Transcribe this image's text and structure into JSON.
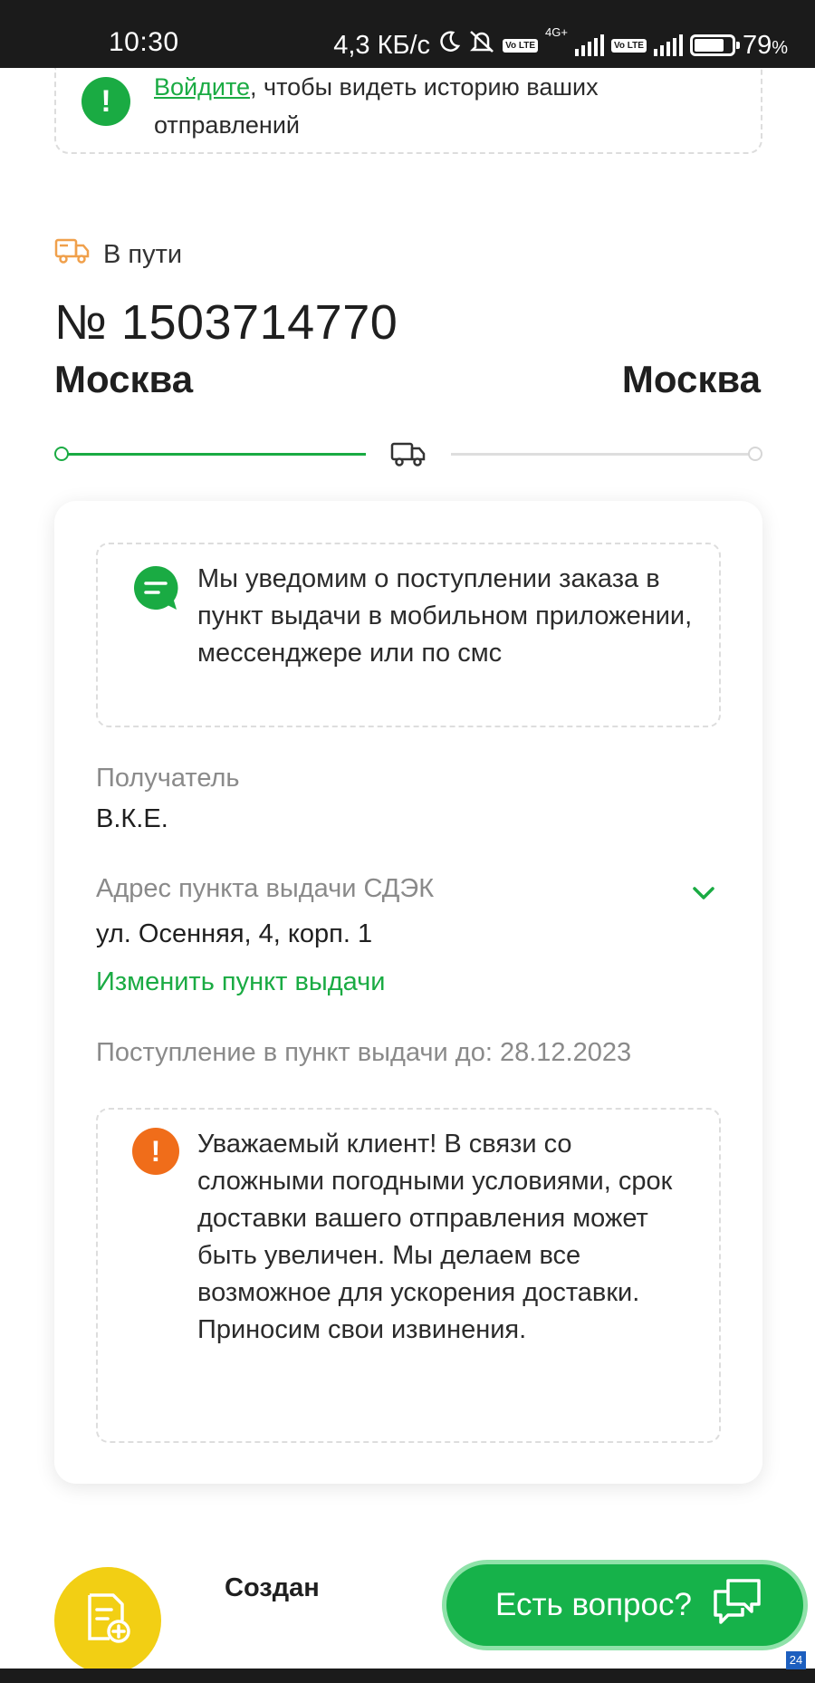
{
  "status_bar": {
    "time": "10:30",
    "network_speed": "4,3 КБ/с",
    "lte_chip": "Vo LTE",
    "network_type": "4G+",
    "battery_percent": "79",
    "battery_unit": "%",
    "battery_level": 0.79
  },
  "login_notice": {
    "link_text": "Войдите",
    "rest_text": ", чтобы видеть историю ваших отправлений"
  },
  "shipment": {
    "status_text": "В пути",
    "number": "№ 1503714770",
    "city_from": "Москва",
    "city_to": "Москва",
    "progress_fraction": 0.5
  },
  "card": {
    "notify_text": "Мы уведомим о поступлении заказа в пункт выдачи в мобильном приложении, мессенджере или по смс",
    "recipient_label": "Получатель",
    "recipient_value": "В.К.Е.",
    "address_label": "Адрес пункта выдачи СДЭК",
    "address_value": "ул. Осенняя, 4, корп. 1",
    "change_link": "Изменить пункт выдачи",
    "arrival_text": "Поступление в пункт выдачи до: 28.12.2023",
    "warning_text": "Уважаемый клиент! В связи со сложными погодными условиями, срок доставки вашего отправления может быть увеличен. Мы делаем все возможное для ускорения доставки. Приносим свои извинения."
  },
  "bottom": {
    "created_label": "Создан",
    "ask_button": "Есть вопрос?",
    "corner_badge": "24"
  },
  "colors": {
    "brand_green": "#1aab43",
    "warning_orange": "#f06d1a",
    "doc_yellow": "#f2cf14",
    "truck_orange": "#f0a04b"
  },
  "icons": {
    "status_truck": "truck-icon",
    "progress_truck": "truck-icon",
    "notify": "chat-bubble-icon",
    "warning": "exclamation-icon",
    "login": "exclamation-icon",
    "address": "chevron-down-icon",
    "doc_fab": "document-add-icon",
    "ask": "chat-bubbles-icon"
  }
}
